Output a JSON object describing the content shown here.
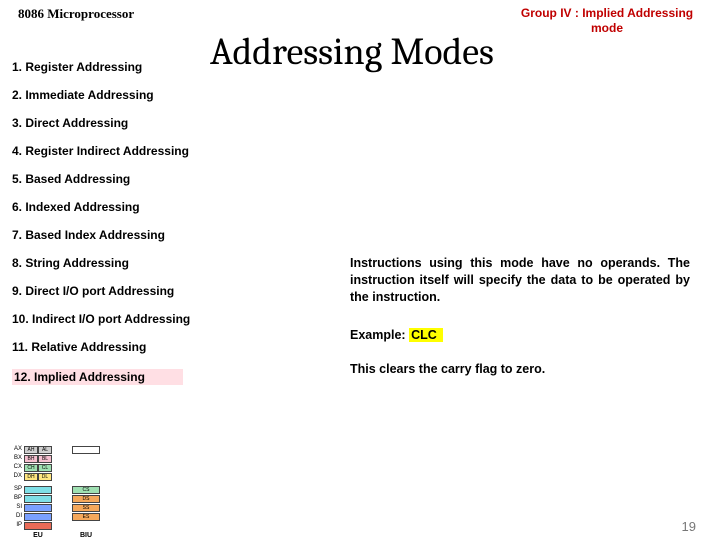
{
  "header": {
    "left": "8086 Microprocessor",
    "right": "Group IV : Implied Addressing mode"
  },
  "title": "Addressing Modes",
  "list": {
    "items": [
      "1.  Register Addressing",
      "2.  Immediate Addressing",
      "3.  Direct Addressing",
      "4.  Register Indirect Addressing",
      "5.  Based Addressing",
      "6.  Indexed Addressing",
      "7.  Based Index Addressing",
      "8.  String Addressing",
      "9.  Direct I/O port Addressing",
      "10. Indirect I/O port Addressing",
      "11. Relative Addressing",
      "12. Implied Addressing"
    ]
  },
  "body": {
    "paragraph": "Instructions using this mode have no operands. The instruction itself will specify the data to be operated by the instruction.",
    "example_label": "Example:",
    "example_code": "CLC",
    "result": "This clears the carry flag to zero."
  },
  "diagram": {
    "top_rows": [
      {
        "lbl": "AX",
        "cells": [
          "AH",
          "AL"
        ],
        "cls": "c-grey"
      },
      {
        "lbl": "BX",
        "cells": [
          "BH",
          "BL"
        ],
        "cls": "c-pink"
      },
      {
        "lbl": "CX",
        "cells": [
          "CH",
          "CL"
        ],
        "cls": "c-green"
      },
      {
        "lbl": "DX",
        "cells": [
          "DH",
          "DL"
        ],
        "cls": "c-yel"
      }
    ],
    "left_rows": [
      {
        "lbl": "SP",
        "cls": "c-cyan"
      },
      {
        "lbl": "BP",
        "cls": "c-cyan"
      },
      {
        "lbl": "SI",
        "cls": "c-blue"
      },
      {
        "lbl": "DI",
        "cls": "c-blue"
      },
      {
        "lbl": "IP",
        "cls": "c-red"
      }
    ],
    "right_rows": [
      {
        "lbl": "CS",
        "cls": "c-green"
      },
      {
        "lbl": "DS",
        "cls": "c-orange"
      },
      {
        "lbl": "SS",
        "cls": "c-orange"
      },
      {
        "lbl": "ES",
        "cls": "c-orange"
      }
    ],
    "foot": [
      "EU",
      "BIU"
    ]
  },
  "page_number": "19"
}
